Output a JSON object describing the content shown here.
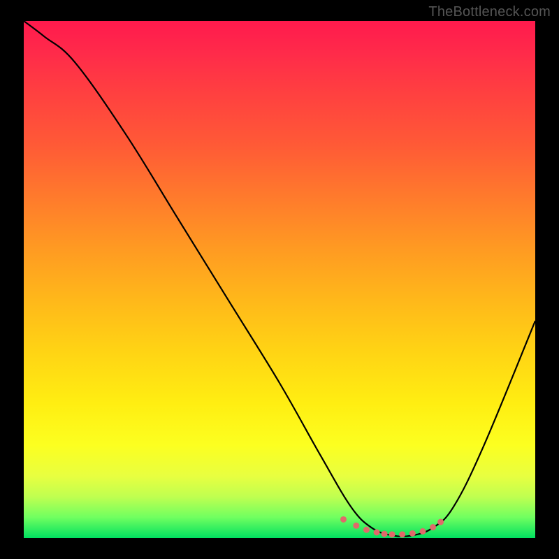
{
  "watermark": "TheBottleneck.com",
  "chart_data": {
    "type": "line",
    "title": "",
    "xlabel": "",
    "ylabel": "",
    "xlim": [
      0,
      100
    ],
    "ylim": [
      0,
      100
    ],
    "series": [
      {
        "name": "curve",
        "color": "#000000",
        "x": [
          0,
          4,
          10,
          20,
          30,
          40,
          50,
          58,
          64,
          68,
          72,
          76,
          80,
          84,
          90,
          100
        ],
        "y": [
          100,
          97,
          92,
          78,
          62,
          46,
          30,
          16,
          6,
          2,
          0.5,
          0.5,
          2,
          6,
          18,
          42
        ]
      }
    ],
    "markers": {
      "name": "dotted-valley",
      "color": "#e06a6a",
      "x": [
        62.5,
        65,
        67,
        69,
        70.5,
        72,
        74,
        76,
        78,
        80,
        81.5
      ],
      "y": [
        3.6,
        2.4,
        1.6,
        1.1,
        0.8,
        0.7,
        0.7,
        0.9,
        1.3,
        2.1,
        3.1
      ]
    },
    "gradient_stops": [
      {
        "pos": 0.0,
        "color": "#ff1a4d"
      },
      {
        "pos": 0.5,
        "color": "#ffc018"
      },
      {
        "pos": 0.82,
        "color": "#fcff20"
      },
      {
        "pos": 1.0,
        "color": "#00e060"
      }
    ]
  }
}
